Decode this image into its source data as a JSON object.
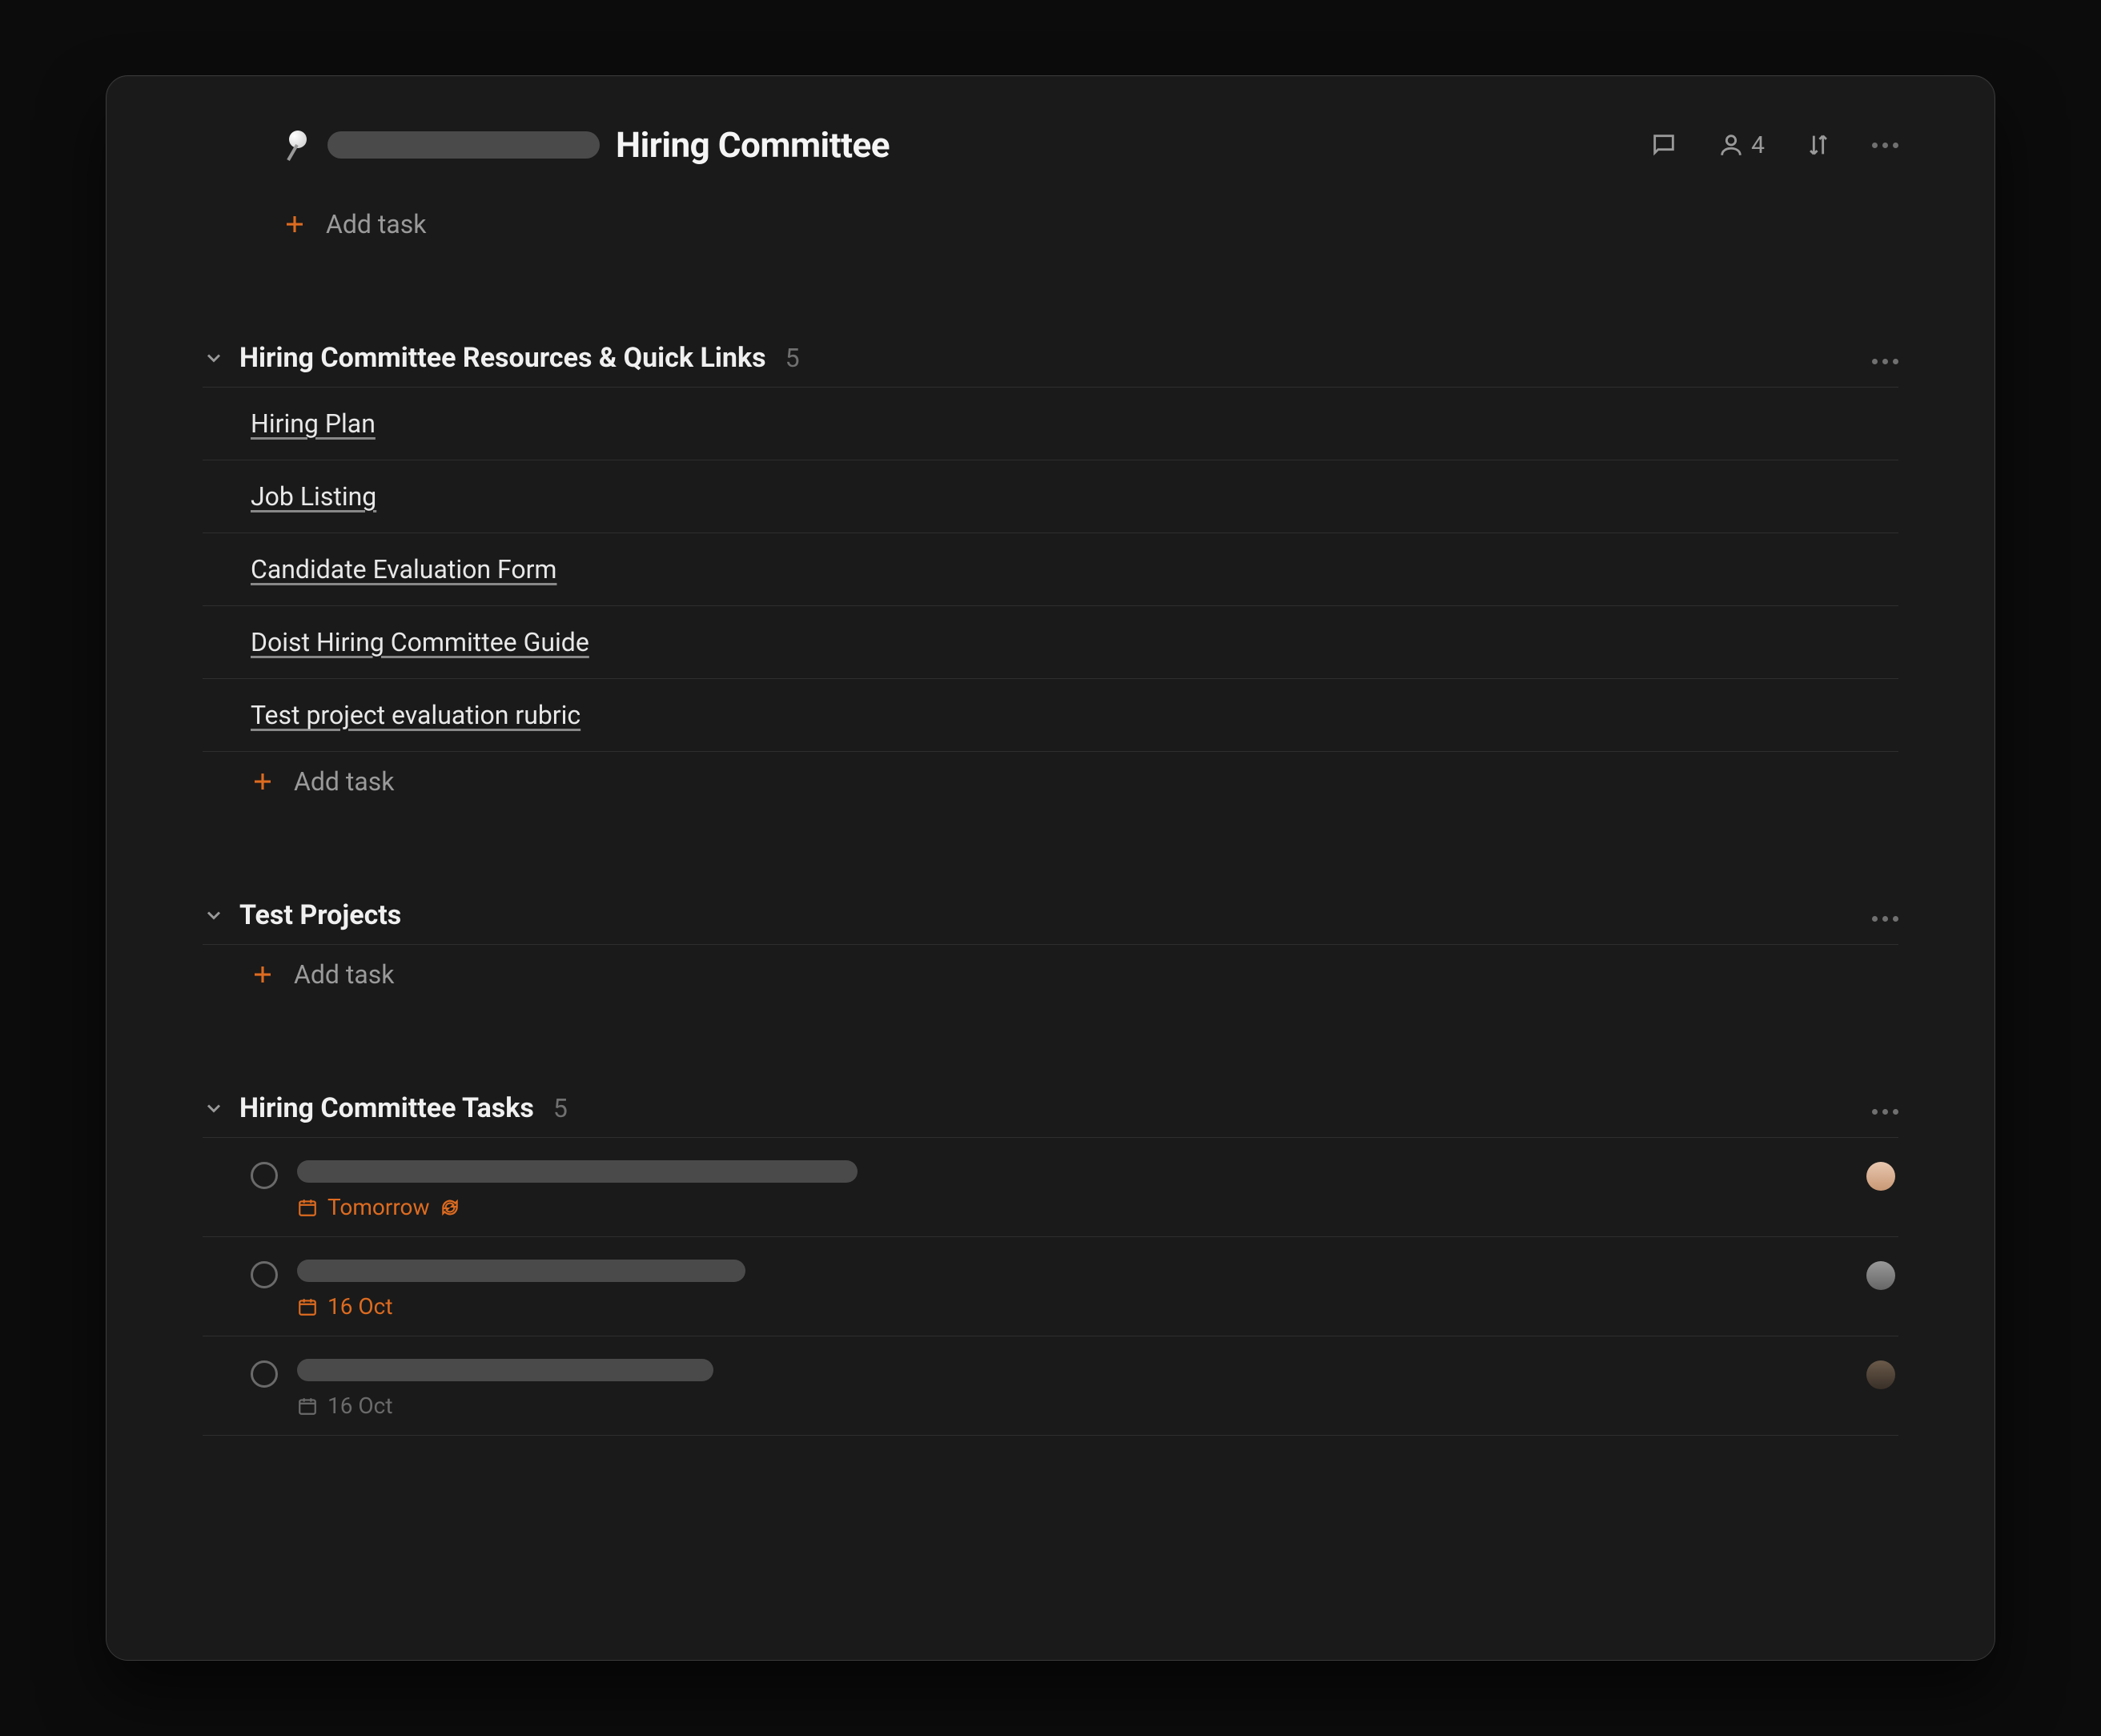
{
  "header": {
    "project_title": "Hiring Committee",
    "share_count": "4",
    "add_task_label": "Add task"
  },
  "sections": [
    {
      "title": "Hiring Committee Resources & Quick Links",
      "count": "5",
      "add_task_label": "Add task",
      "items": [
        {
          "title": "Hiring Plan"
        },
        {
          "title": "Job Listing"
        },
        {
          "title": "Candidate Evaluation Form"
        },
        {
          "title": "Doist Hiring Committee Guide"
        },
        {
          "title": "Test project evaluation rubric"
        }
      ]
    },
    {
      "title": "Test Projects",
      "add_task_label": "Add task"
    },
    {
      "title": "Hiring Committee Tasks",
      "count": "5",
      "tasks": [
        {
          "date_label": "Tomorrow",
          "recurring": true,
          "title_width": 700,
          "muted": false
        },
        {
          "date_label": "16 Oct",
          "recurring": false,
          "title_width": 560,
          "muted": false
        },
        {
          "date_label": "16 Oct",
          "recurring": false,
          "title_width": 520,
          "muted": true
        }
      ]
    }
  ],
  "avatar_colors": [
    "#d9a78a",
    "#8a8a8a",
    "#5a4a3a"
  ]
}
